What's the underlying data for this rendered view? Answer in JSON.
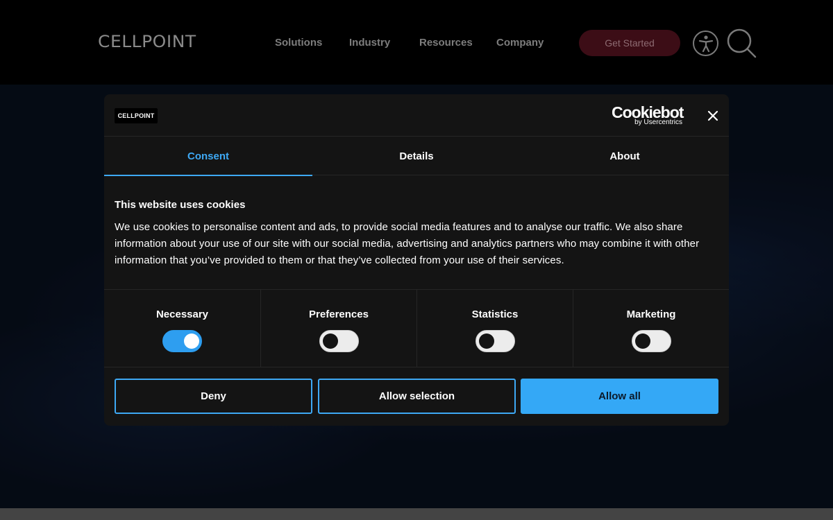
{
  "site": {
    "logo": "CELLPOINT",
    "nav": [
      "Solutions",
      "Industry",
      "Resources",
      "Company"
    ],
    "cta_label": "Get Started",
    "icons": [
      "accessibility-icon",
      "search-icon"
    ]
  },
  "dialog": {
    "brand_logo": "CELLPOINT",
    "provider_name": "Cookiebot",
    "provider_sub": "by Usercentrics",
    "close_icon": "close-icon",
    "tabs": [
      {
        "label": "Consent",
        "active": true
      },
      {
        "label": "Details",
        "active": false
      },
      {
        "label": "About",
        "active": false
      }
    ],
    "title": "This website uses cookies",
    "body": "We use cookies to personalise content and ads, to provide social media features and to analyse our traffic. We also share information about your use of our site with our social media, advertising and analytics partners who may combine it with other information that you’ve provided to them or that they’ve collected from your use of their services.",
    "categories": [
      {
        "label": "Necessary",
        "checked": true
      },
      {
        "label": "Preferences",
        "checked": false
      },
      {
        "label": "Statistics",
        "checked": false
      },
      {
        "label": "Marketing",
        "checked": false
      }
    ],
    "buttons": {
      "deny": "Deny",
      "allow_selection": "Allow selection",
      "allow_all": "Allow all"
    }
  },
  "colors": {
    "accent": "#34a8f6",
    "dialog_bg": "#141414",
    "cta_bg": "#3c0d16"
  }
}
